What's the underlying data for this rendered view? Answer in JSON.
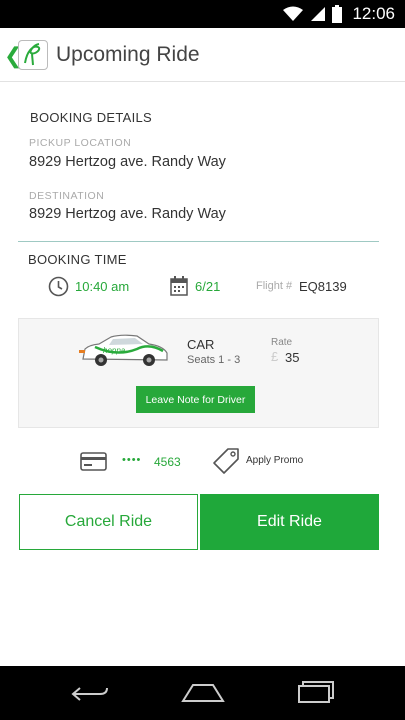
{
  "status_bar": {
    "time": "12:06"
  },
  "header": {
    "back_icon": "chevron-left-icon",
    "title": "Upcoming Ride"
  },
  "booking_details": {
    "title": "BOOKING DETAILS",
    "pickup_label": "PICKUP LOCATION",
    "pickup_value": "8929 Hertzog ave. Randy Way",
    "destination_label": "DESTINATION",
    "destination_value": "8929 Hertzog ave. Randy Way"
  },
  "booking_time": {
    "title": "BOOKING TIME",
    "time": "10:40 am",
    "date": "6/21",
    "flight_label": "Flight #",
    "flight_value": "EQ8139"
  },
  "ride": {
    "car_brand_text": "hoppa",
    "vehicle_type": "CAR",
    "seats": "Seats 1 - 3",
    "rate_label": "Rate",
    "currency_symbol": "£",
    "rate_value": "35",
    "note_button": "Leave Note for Driver"
  },
  "payment": {
    "card_dots": "••••",
    "card_last4": "4563",
    "promo_label": "Apply Promo"
  },
  "actions": {
    "cancel_label": "Cancel Ride",
    "edit_label": "Edit Ride"
  },
  "colors": {
    "accent": "#27a83a",
    "divider": "#9fc9c3",
    "ride_card_bg": "#f6f6f6"
  }
}
